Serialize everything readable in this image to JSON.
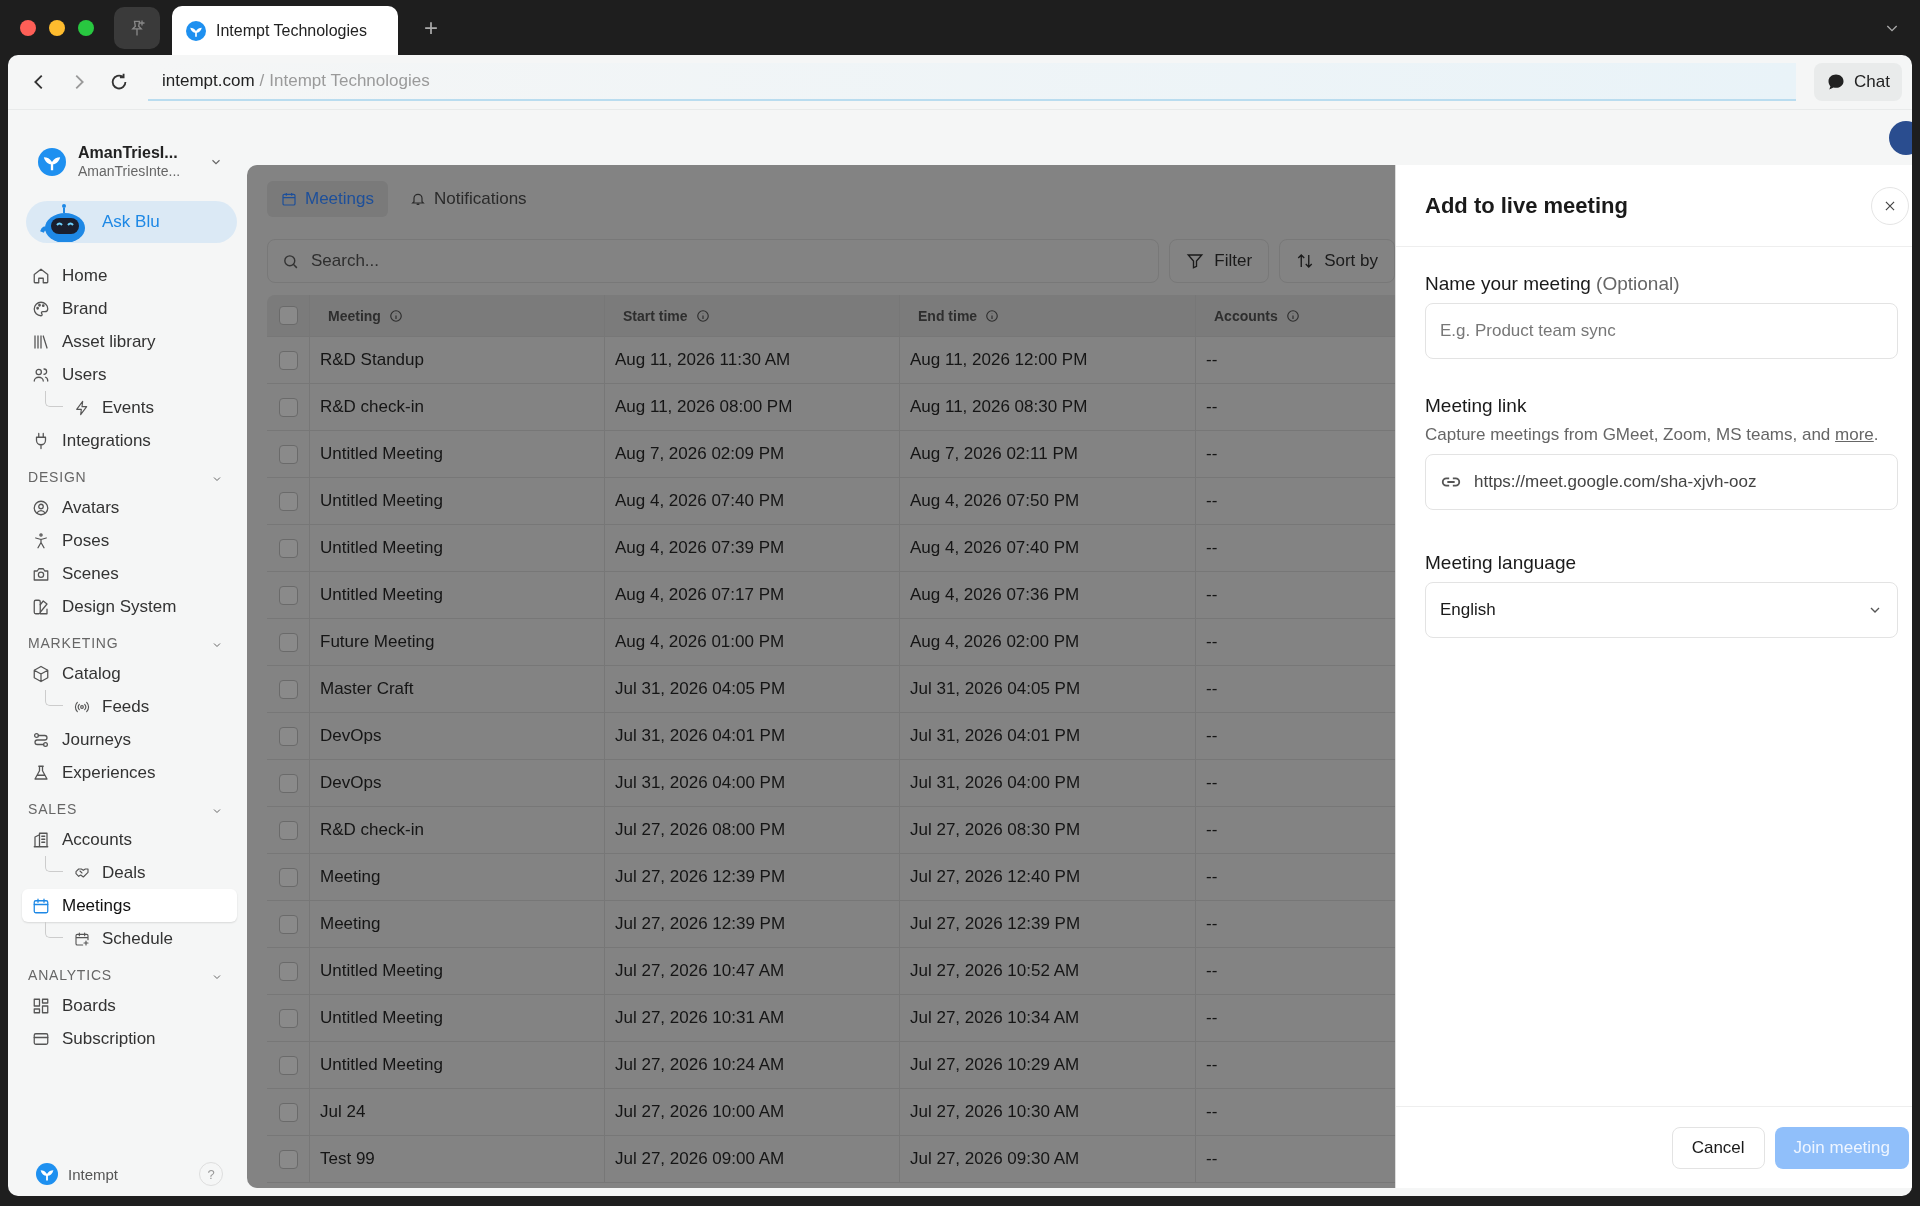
{
  "browser": {
    "tab_title": "Intempt Technologies",
    "new_tab": "+",
    "url_domain": "intempt.com",
    "url_separator": "/",
    "url_page": "Intempt Technologies",
    "chat_button": "Chat"
  },
  "workspace": {
    "name": "AmanTriesI...",
    "subtitle": "AmanTriesInte..."
  },
  "ask_blu": "Ask Blu",
  "sidebar": {
    "sections": [
      {
        "items": [
          {
            "label": "Home",
            "selected": false
          },
          {
            "label": "Brand",
            "selected": false
          },
          {
            "label": "Asset library",
            "selected": false
          },
          {
            "label": "Users",
            "selected": false,
            "children": [
              {
                "label": "Events",
                "selected": false
              }
            ]
          },
          {
            "label": "Integrations",
            "selected": false
          }
        ]
      },
      {
        "heading": "DESIGN",
        "expanded": true,
        "items": [
          {
            "label": "Avatars",
            "selected": false
          },
          {
            "label": "Poses",
            "selected": false
          },
          {
            "label": "Scenes",
            "selected": false
          },
          {
            "label": "Design System",
            "selected": false
          }
        ]
      },
      {
        "heading": "MARKETING",
        "expanded": true,
        "items": [
          {
            "label": "Catalog",
            "selected": false,
            "children": [
              {
                "label": "Feeds",
                "selected": false
              }
            ]
          },
          {
            "label": "Journeys",
            "selected": false
          },
          {
            "label": "Experiences",
            "selected": false
          }
        ]
      },
      {
        "heading": "SALES",
        "expanded": true,
        "items": [
          {
            "label": "Accounts",
            "selected": false,
            "children": [
              {
                "label": "Deals",
                "selected": false
              }
            ]
          },
          {
            "label": "Meetings",
            "selected": true,
            "children": [
              {
                "label": "Schedule",
                "selected": false
              }
            ]
          }
        ]
      },
      {
        "heading": "ANALYTICS",
        "expanded": true,
        "items": [
          {
            "label": "Boards",
            "selected": false
          },
          {
            "label": "Subscription",
            "selected": false
          }
        ]
      }
    ],
    "footer": {
      "brand": "Intempt",
      "help": "?"
    }
  },
  "main": {
    "tabs": [
      {
        "label": "Meetings",
        "selected": true
      },
      {
        "label": "Notifications",
        "selected": false
      }
    ],
    "search": {
      "placeholder": "Search..."
    },
    "buttons": [
      "Filter",
      "Sort by"
    ],
    "table": {
      "all_checked": false,
      "columns": [
        "Meeting",
        "Start time",
        "End time",
        "Accounts"
      ],
      "rows": [
        {
          "checked": false,
          "cells": [
            "R&D Standup",
            "Aug 11, 2026 11:30 AM",
            "Aug 11, 2026 12:00 PM",
            "--"
          ]
        },
        {
          "checked": false,
          "cells": [
            "R&D check-in",
            "Aug 11, 2026 08:00 PM",
            "Aug 11, 2026 08:30 PM",
            "--"
          ]
        },
        {
          "checked": false,
          "cells": [
            "Untitled Meeting",
            "Aug 7, 2026 02:09 PM",
            "Aug 7, 2026 02:11 PM",
            "--"
          ]
        },
        {
          "checked": false,
          "cells": [
            "Untitled Meeting",
            "Aug 4, 2026 07:40 PM",
            "Aug 4, 2026 07:50 PM",
            "--"
          ]
        },
        {
          "checked": false,
          "cells": [
            "Untitled Meeting",
            "Aug 4, 2026 07:39 PM",
            "Aug 4, 2026 07:40 PM",
            "--"
          ]
        },
        {
          "checked": false,
          "cells": [
            "Untitled Meeting",
            "Aug 4, 2026 07:17 PM",
            "Aug 4, 2026 07:36 PM",
            "--"
          ]
        },
        {
          "checked": false,
          "cells": [
            "Future Meeting",
            "Aug 4, 2026 01:00 PM",
            "Aug 4, 2026 02:00 PM",
            "--"
          ]
        },
        {
          "checked": false,
          "cells": [
            "Master Craft",
            "Jul 31, 2026 04:05 PM",
            "Jul 31, 2026 04:05 PM",
            "--"
          ]
        },
        {
          "checked": false,
          "cells": [
            "DevOps",
            "Jul 31, 2026 04:01 PM",
            "Jul 31, 2026 04:01 PM",
            "--"
          ]
        },
        {
          "checked": false,
          "cells": [
            "DevOps",
            "Jul 31, 2026 04:00 PM",
            "Jul 31, 2026 04:00 PM",
            "--"
          ]
        },
        {
          "checked": false,
          "cells": [
            "R&D check-in",
            "Jul 27, 2026 08:00 PM",
            "Jul 27, 2026 08:30 PM",
            "--"
          ]
        },
        {
          "checked": false,
          "cells": [
            "Meeting",
            "Jul 27, 2026 12:39 PM",
            "Jul 27, 2026 12:40 PM",
            "--"
          ]
        },
        {
          "checked": false,
          "cells": [
            "Meeting",
            "Jul 27, 2026 12:39 PM",
            "Jul 27, 2026 12:39 PM",
            "--"
          ]
        },
        {
          "checked": false,
          "cells": [
            "Untitled Meeting",
            "Jul 27, 2026 10:47 AM",
            "Jul 27, 2026 10:52 AM",
            "--"
          ]
        },
        {
          "checked": false,
          "cells": [
            "Untitled Meeting",
            "Jul 27, 2026 10:31 AM",
            "Jul 27, 2026 10:34 AM",
            "--"
          ]
        },
        {
          "checked": false,
          "cells": [
            "Untitled Meeting",
            "Jul 27, 2026 10:24 AM",
            "Jul 27, 2026 10:29 AM",
            "--"
          ]
        },
        {
          "checked": false,
          "cells": [
            "Jul 24",
            "Jul 27, 2026 10:00 AM",
            "Jul 27, 2026 10:30 AM",
            "--"
          ]
        },
        {
          "checked": false,
          "cells": [
            "Test 99",
            "Jul 27, 2026 09:00 AM",
            "Jul 27, 2026 09:30 AM",
            "--"
          ]
        }
      ]
    }
  },
  "panel": {
    "title": "Add to live meeting",
    "name_label": "Name your meeting",
    "name_optional": "(Optional)",
    "name_placeholder": "E.g. Product team sync",
    "link_label": "Meeting link",
    "link_description": "Capture meetings from GMeet, Zoom, MS teams, and",
    "link_more": "more",
    "link_period": ".",
    "link_value": "https://meet.google.com/sha-xjvh-ooz",
    "language_label": "Meeting language",
    "language_value": "English",
    "cancel": "Cancel",
    "join": {
      "label": "Join meeting",
      "disabled": true
    }
  }
}
